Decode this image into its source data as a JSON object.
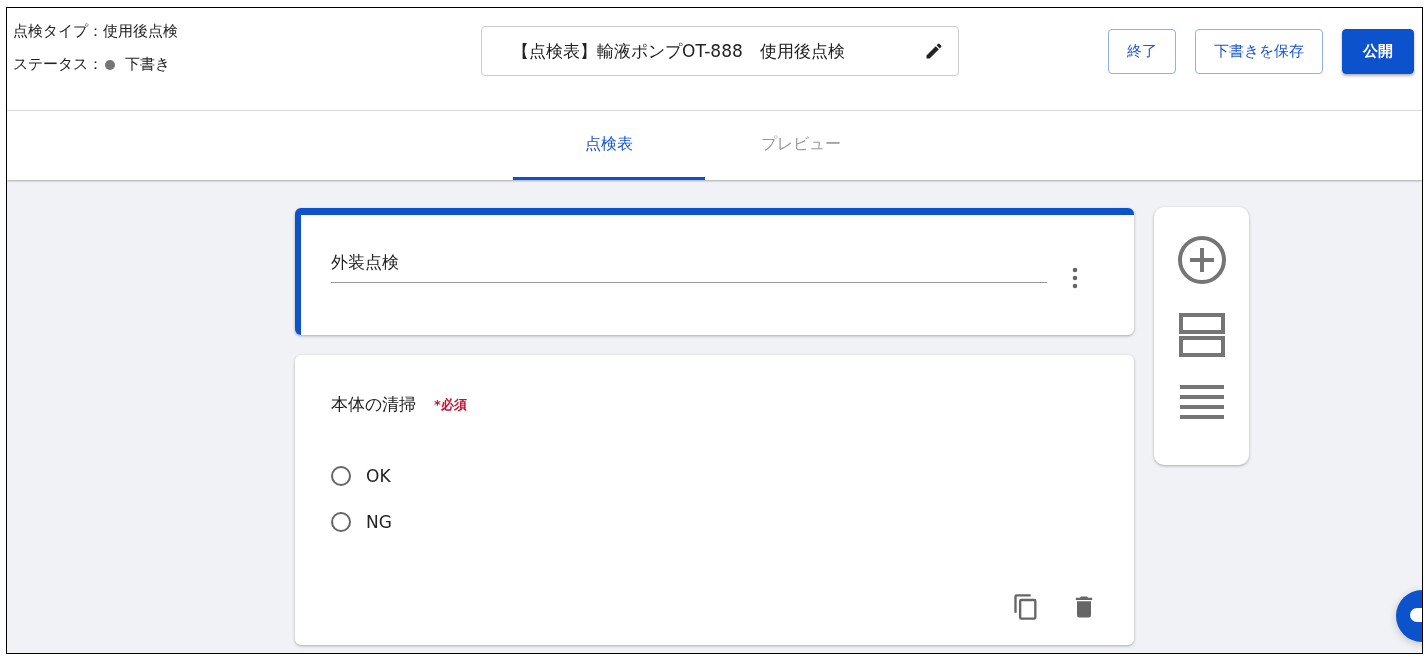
{
  "header": {
    "inspection_type": "点検タイプ：使用後点検",
    "status_label": "ステータス：",
    "status_value": "下書き",
    "title": "【点検表】輸液ポンプOT-888　使用後点検",
    "buttons": [
      {
        "label": "終了",
        "kind": "outline"
      },
      {
        "label": "下書きを保存",
        "kind": "outline"
      },
      {
        "label": "公開",
        "kind": "primary"
      }
    ]
  },
  "tabs": [
    {
      "label": "点検表",
      "selected": true
    },
    {
      "label": "プレビュー",
      "selected": false
    }
  ],
  "section": {
    "title": "外装点検"
  },
  "question": {
    "title": "本体の清掃",
    "required": "*必須",
    "options": [
      {
        "label": "OK",
        "selected": false
      },
      {
        "label": "NG",
        "selected": false
      }
    ]
  }
}
